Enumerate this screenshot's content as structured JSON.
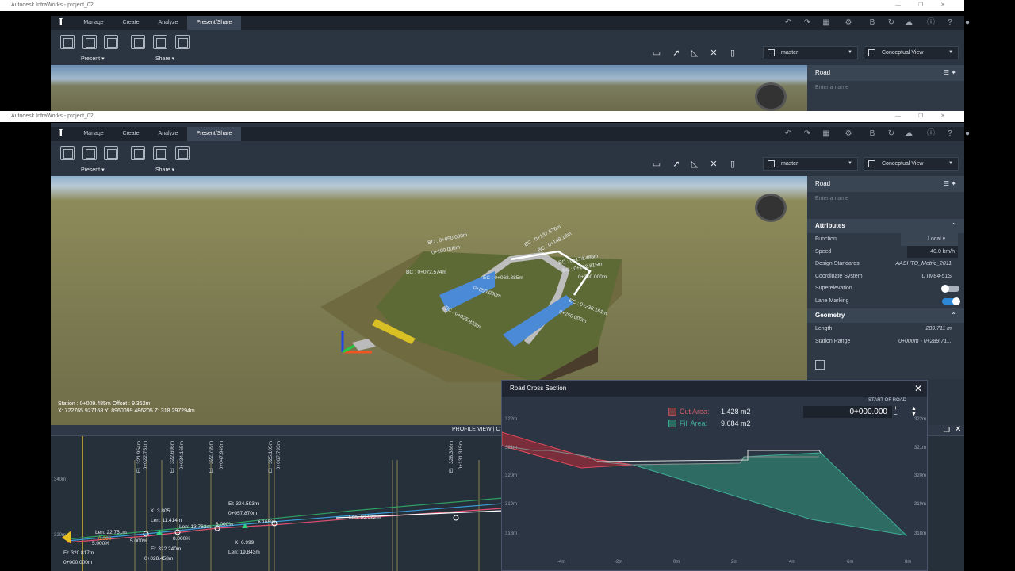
{
  "app": {
    "title_top": "Autodesk InfraWorks - project_02",
    "title_main": "Autodesk InfraWorks - project_02",
    "window_controls": "—  ❐  ✕"
  },
  "tabs": [
    "Manage",
    "Create",
    "Analyze",
    "Present/Share"
  ],
  "ribbon": {
    "present_label": "Present",
    "share_label": "Share",
    "branch": "master",
    "view_style": "Conceptual View"
  },
  "icons": [
    "undo-icon",
    "redo-icon",
    "grid-icon",
    "gear-icon",
    "b-icon",
    "refresh-icon",
    "cloud-icon",
    "info-icon",
    "help-icon",
    "user-icon"
  ],
  "panel": {
    "title": "Road",
    "name_placeholder": "Enter a name",
    "attributes_label": "Attributes",
    "attributes": [
      {
        "label": "Function",
        "value": "Local"
      },
      {
        "label": "Speed",
        "value": "40.0  km/h"
      },
      {
        "label": "Design Standards",
        "value": "AASHTO_Metric_2011"
      },
      {
        "label": "Coordinate System",
        "value": "UTM84-51S"
      },
      {
        "label": "Superelevation",
        "value": ""
      },
      {
        "label": "Lane Marking",
        "value": ""
      }
    ],
    "geometry_label": "Geometry",
    "geometry": [
      {
        "label": "Length",
        "value": "289.711  m"
      },
      {
        "label": "Station Range",
        "value": "0+000m - 0+289.71..."
      }
    ]
  },
  "viewport": {
    "station_text": "Station : 0+009.485m Offset : 9.362m",
    "coords_text": "X: 722765.927168 Y: 8960099.486205 Z: 318.297294m",
    "road_labels": [
      "BC : 0+050.000m",
      "0+100.000m",
      "BC : 0+072.574m",
      "EC : 0+068.885m",
      "0+050.000m",
      "BC : 0+025.933m",
      "EC : 0+137.576m",
      "BC : 0+148.18m",
      "EC : 0+174.486m",
      "BC : 0+182.815m",
      "0+200.000m",
      "EC : 0+238.161m",
      "0+250.000m"
    ]
  },
  "profile": {
    "title": "PROFILE VIEW | C",
    "elev_340": "340m",
    "elev_320": "320m",
    "vertical_labels": [
      "El : 321.954m",
      "0+022.751m",
      "El : 322.696m",
      "0+034.165m",
      "El : 322.799m",
      "0+047.949m",
      "El : 325.105m",
      "0+067.793m",
      "El : 328.386m",
      "0+131.315m"
    ],
    "annotations": [
      "Len: 22.751m",
      "0.000",
      "5.000%",
      "5.000%",
      "K: 3.805",
      "Len: 11.414m",
      "El: 322.240m",
      "0+028.458m",
      "8.000%",
      "Len: 13.783m",
      "6.000%",
      "El: 324.593m",
      "0+057.870m",
      "K: 6.999",
      "Len: 19.843m",
      "6.165%",
      "Len: 63.522m",
      "El: 320.817m",
      "0+000.000m"
    ]
  },
  "cross_section": {
    "title": "Road Cross Section",
    "cut_label": "Cut Area:",
    "cut_value": "1.428 m2",
    "fill_label": "Fill Area:",
    "fill_value": "9.684 m2",
    "station_label": "START OF ROAD",
    "station_value": "0+000.000",
    "y_ticks": [
      "322m",
      "321m",
      "320m",
      "319m",
      "318m"
    ],
    "x_ticks": [
      "-4m",
      "-2m",
      "0m",
      "2m",
      "4m",
      "6m",
      "8m"
    ]
  }
}
